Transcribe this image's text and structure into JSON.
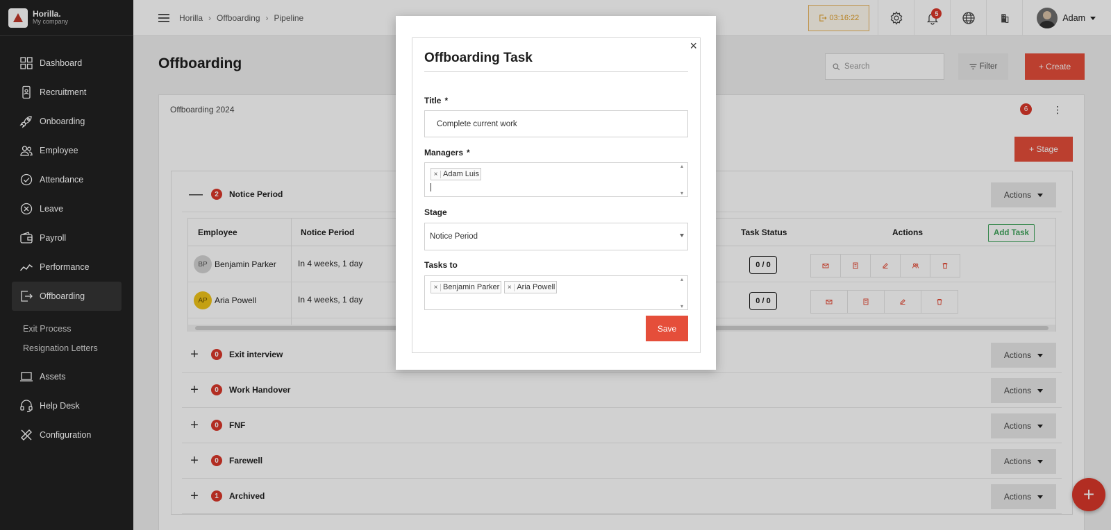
{
  "brand": {
    "name": "Horilla.",
    "company": "My company"
  },
  "sidebar": {
    "items": [
      {
        "label": "Dashboard",
        "icon": "dashboard-icon"
      },
      {
        "label": "Recruitment",
        "icon": "recruitment-icon"
      },
      {
        "label": "Onboarding",
        "icon": "rocket-icon"
      },
      {
        "label": "Employee",
        "icon": "users-icon"
      },
      {
        "label": "Attendance",
        "icon": "check-circle-icon"
      },
      {
        "label": "Leave",
        "icon": "x-circle-icon"
      },
      {
        "label": "Payroll",
        "icon": "wallet-icon"
      },
      {
        "label": "Performance",
        "icon": "chart-line-icon"
      },
      {
        "label": "Offboarding",
        "icon": "exit-icon",
        "active": true
      }
    ],
    "subitems": [
      "Exit Process",
      "Resignation Letters"
    ],
    "items_bottom": [
      {
        "label": "Assets",
        "icon": "laptop-icon"
      },
      {
        "label": "Help Desk",
        "icon": "headset-icon"
      },
      {
        "label": "Configuration",
        "icon": "tools-icon"
      }
    ]
  },
  "topbar": {
    "breadcrumb": [
      "Horilla",
      "Offboarding",
      "Pipeline"
    ],
    "timer": "03:16:22",
    "notifications_count": "5",
    "user_name": "Adam"
  },
  "page": {
    "title": "Offboarding",
    "search_placeholder": "Search",
    "filter_label": "Filter",
    "create_label": "+ Create"
  },
  "panel": {
    "title": "Offboarding 2024",
    "badge": "6",
    "stage_button": "+ Stage"
  },
  "stages": [
    {
      "name": "Notice Period",
      "count": "2",
      "expanded": true
    },
    {
      "name": "Exit interview",
      "count": "0"
    },
    {
      "name": "Work Handover",
      "count": "0"
    },
    {
      "name": "FNF",
      "count": "0"
    },
    {
      "name": "Farewell",
      "count": "0"
    },
    {
      "name": "Archived",
      "count": "1"
    }
  ],
  "actions_label": "Actions",
  "table": {
    "headers": [
      "Employee",
      "Notice Period",
      "Task Status",
      "Actions"
    ],
    "add_task_label": "Add Task",
    "rows": [
      {
        "initials": "BP",
        "name": "Benjamin Parker",
        "notice": "In 4 weeks, 1 day",
        "status": "0 / 0",
        "avatar_color": "#d4d4d4"
      },
      {
        "initials": "AP",
        "name": "Aria Powell",
        "notice": "In 4 weeks, 1 day",
        "status": "0 / 0",
        "avatar_color": "#f0c419"
      }
    ]
  },
  "modal": {
    "title": "Offboarding Task",
    "title_label": "Title",
    "title_value": "Complete current work",
    "managers_label": "Managers",
    "managers": [
      "Adam Luis"
    ],
    "stage_label": "Stage",
    "stage_value": "Notice Period",
    "tasks_to_label": "Tasks to",
    "tasks_to": [
      "Benjamin Parker",
      "Aria Powell"
    ],
    "save_label": "Save",
    "required_mark": "*",
    "close_glyph": "×"
  },
  "colors": {
    "accent": "#e54e3a",
    "badge": "#d9382a",
    "sidebar": "#212121",
    "success": "#3fa45b"
  }
}
